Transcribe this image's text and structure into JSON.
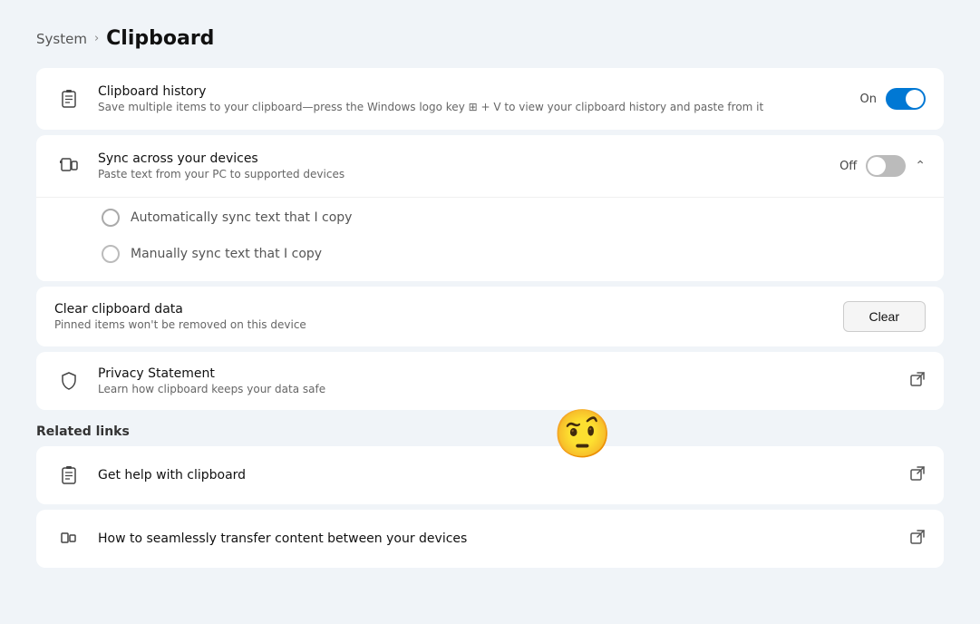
{
  "breadcrumb": {
    "system": "System",
    "chevron": "›",
    "current": "Clipboard"
  },
  "clipboard_history": {
    "title": "Clipboard history",
    "subtitle": "Save multiple items to your clipboard—press the Windows logo key ⊞ + V to view your clipboard history and paste from it",
    "toggle_label": "On",
    "toggle_state": "on"
  },
  "sync_devices": {
    "title": "Sync across your devices",
    "subtitle": "Paste text from your PC to supported devices",
    "toggle_label": "Off",
    "toggle_state": "off",
    "option1": "Automatically sync text that I copy",
    "option2": "Manually sync text that I copy"
  },
  "clear_clipboard": {
    "title": "Clear clipboard data",
    "subtitle": "Pinned items won't be removed on this device",
    "button_label": "Clear"
  },
  "privacy_statement": {
    "title": "Privacy Statement",
    "subtitle": "Learn how clipboard keeps your data safe"
  },
  "related_links": {
    "label": "Related links",
    "link1": "Get help with clipboard",
    "link2": "How to seamlessly transfer content between your devices"
  }
}
